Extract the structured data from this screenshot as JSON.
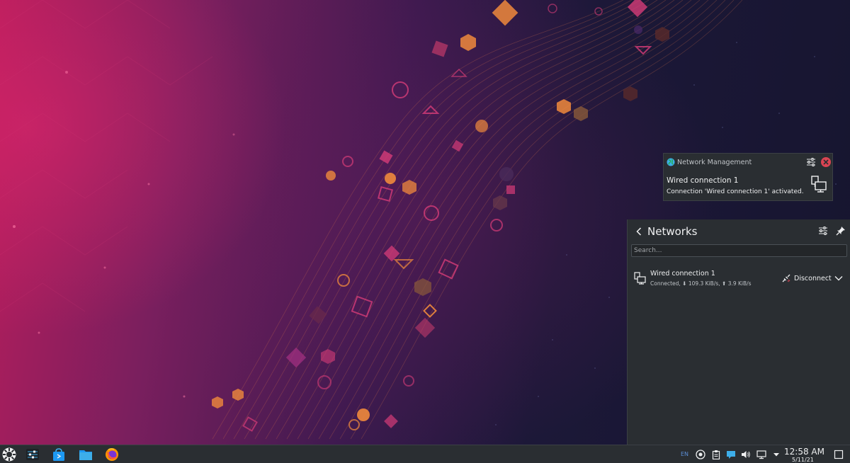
{
  "notification": {
    "app_name": "Network Management",
    "title": "Wired connection 1",
    "body": "Connection 'Wired connection 1' activated.",
    "icons": {
      "app": "globe-icon",
      "configure": "configure-icon",
      "close": "close-icon",
      "content": "wired-network-icon"
    }
  },
  "networks_panel": {
    "title": "Networks",
    "search_placeholder": "Search...",
    "connections": [
      {
        "name": "Wired connection 1",
        "status": "Connected, ⬇ 109.3 KiB/s, ⬆ 3.9 KiB/s",
        "action_label": "Disconnect",
        "icon": "wired-network-icon"
      }
    ]
  },
  "taskbar": {
    "apps": [
      "application-launcher-icon",
      "system-settings-icon",
      "discover-store-icon",
      "file-manager-icon",
      "firefox-icon"
    ],
    "tray": {
      "language": "EN",
      "icons": [
        "updates-icon",
        "clipboard-icon",
        "notifications-icon",
        "volume-icon",
        "network-icon",
        "expand-tray-icon"
      ]
    },
    "clock": {
      "time": "12:58 AM",
      "date": "5/11/21"
    }
  },
  "colors": {
    "panel_bg": "#2a2e32",
    "accent": "#3daee9",
    "close_red": "#da4453"
  }
}
